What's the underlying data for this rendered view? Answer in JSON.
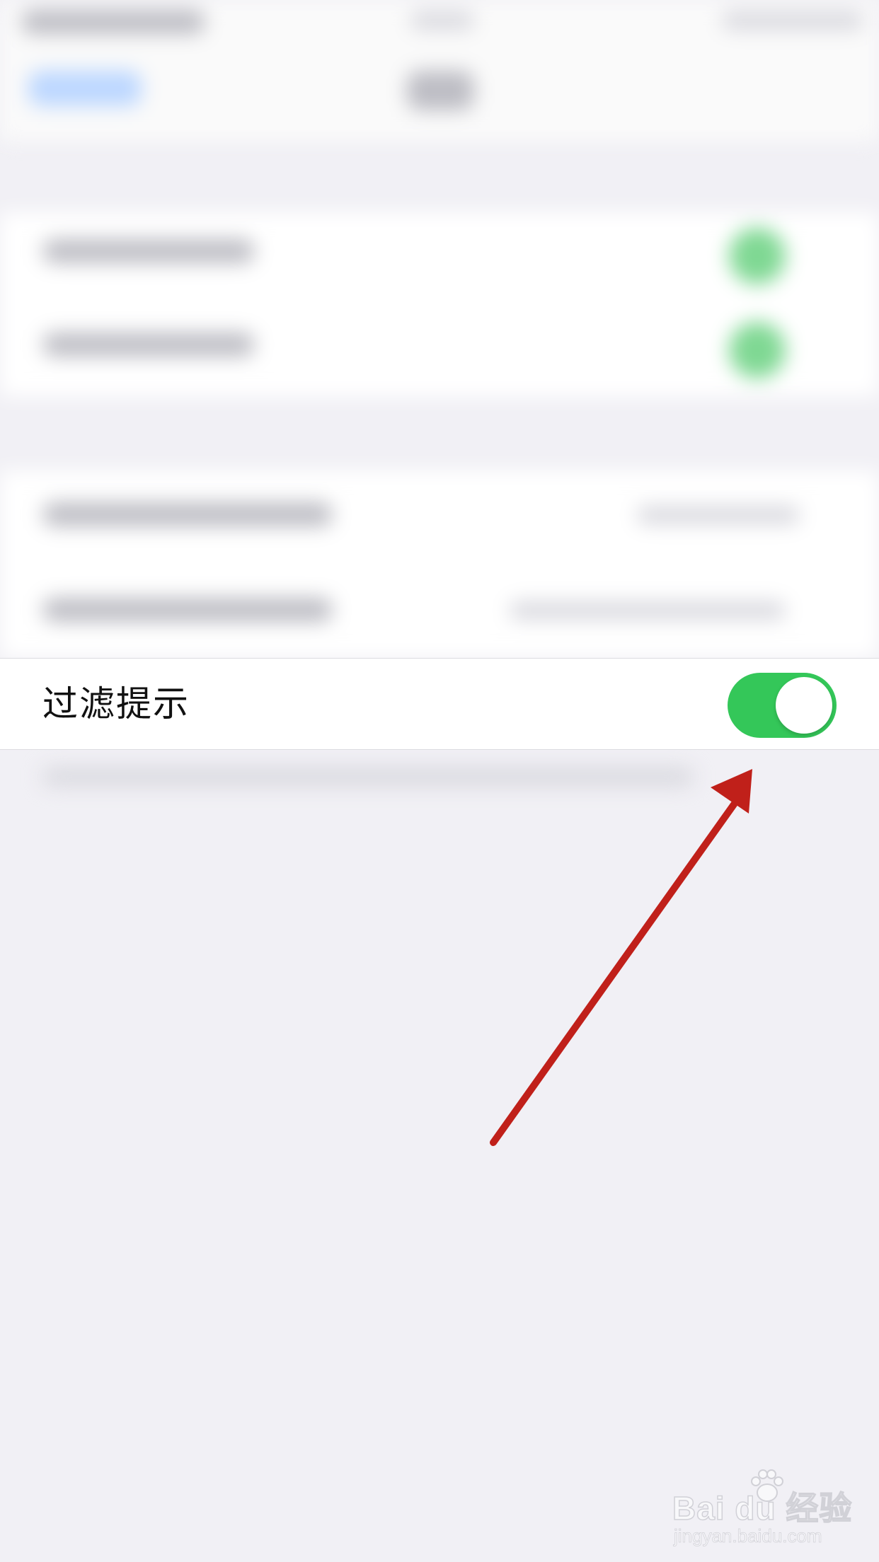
{
  "settings_row": {
    "label": "过滤提示",
    "toggle_on": true
  },
  "colors": {
    "toggle_on": "#34c759",
    "arrow": "#c0201a",
    "background": "#f1f0f5"
  },
  "watermark": {
    "brand": "Bai du 经验",
    "url": "jingyan.baidu.com"
  }
}
